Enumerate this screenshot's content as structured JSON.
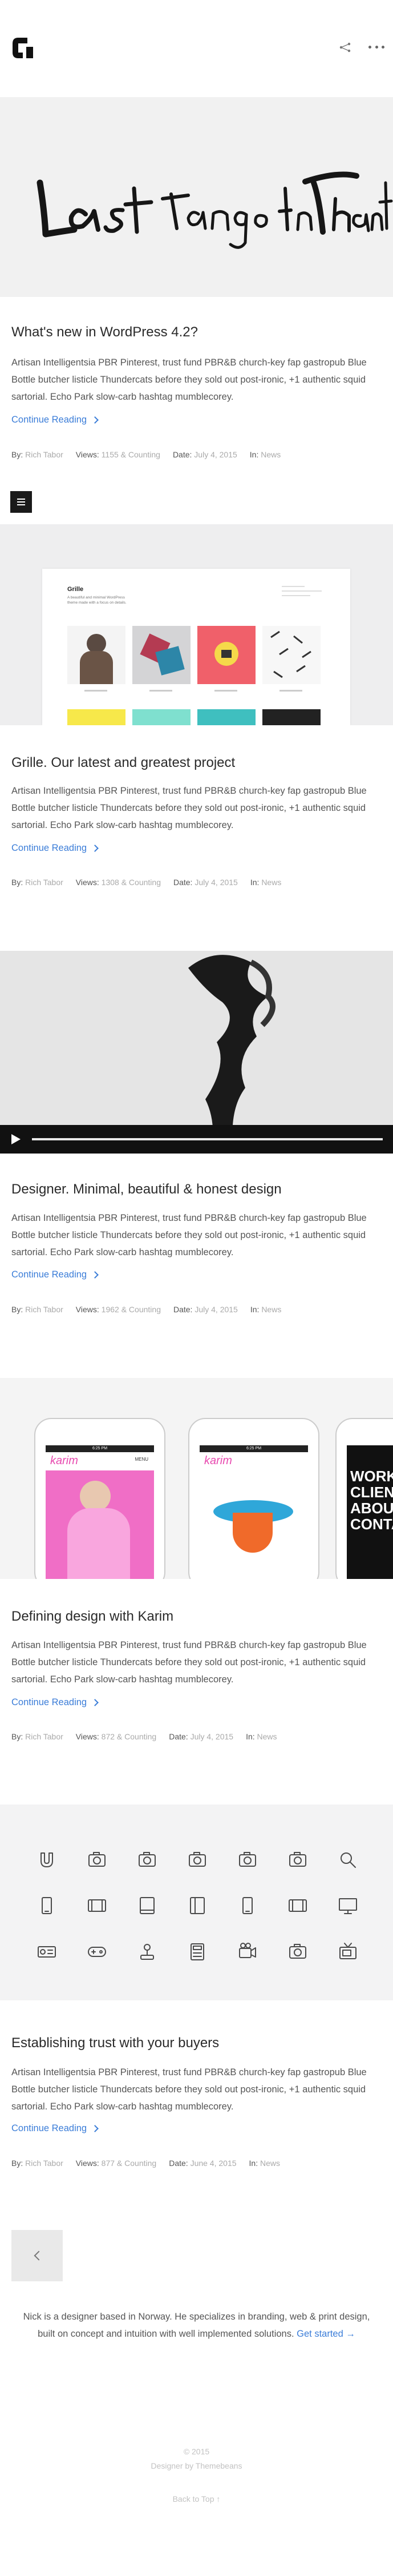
{
  "header": {
    "logo": "brand-logo",
    "share_icon": "share-icon",
    "more_icon": "more-icon"
  },
  "hero1": {
    "lettering": "Last tango in Thanet"
  },
  "posts": [
    {
      "title": "What's new in WordPress 4.2?",
      "excerpt": "Artisan Intelligentsia PBR Pinterest, trust fund PBR&B church-key fap gastropub Blue Bottle butcher listicle Thundercats before they sold out post-ironic, +1 authentic squid sartorial. Echo Park slow-carb hashtag mumblecorey.",
      "read_more": "Continue Reading",
      "by_label": "By:",
      "by": "Rich Tabor",
      "views_label": "Views:",
      "views": "1155 & Counting",
      "date_label": "Date:",
      "date": "July 4, 2015",
      "in_label": "In:",
      "in": "News"
    },
    {
      "title": "Grille. Our latest and greatest project",
      "excerpt": "Artisan Intelligentsia PBR Pinterest, trust fund PBR&B church-key fap gastropub Blue Bottle butcher listicle Thundercats before they sold out post-ironic, +1 authentic squid sartorial. Echo Park slow-carb hashtag mumblecorey.",
      "read_more": "Continue Reading",
      "by_label": "By:",
      "by": "Rich Tabor",
      "views_label": "Views:",
      "views": "1308 & Counting",
      "date_label": "Date:",
      "date": "July 4, 2015",
      "in_label": "In:",
      "in": "News"
    },
    {
      "title": "Designer. Minimal, beautiful & honest design",
      "excerpt": "Artisan Intelligentsia PBR Pinterest, trust fund PBR&B church-key fap gastropub Blue Bottle butcher listicle Thundercats before they sold out post-ironic, +1 authentic squid sartorial. Echo Park slow-carb hashtag mumblecorey.",
      "read_more": "Continue Reading",
      "by_label": "By:",
      "by": "Rich Tabor",
      "views_label": "Views:",
      "views": "1962 & Counting",
      "date_label": "Date:",
      "date": "July 4, 2015",
      "in_label": "In:",
      "in": "News"
    },
    {
      "title": "Defining design with Karim",
      "excerpt": "Artisan Intelligentsia PBR Pinterest, trust fund PBR&B church-key fap gastropub Blue Bottle butcher listicle Thundercats before they sold out post-ironic, +1 authentic squid sartorial. Echo Park slow-carb hashtag mumblecorey.",
      "read_more": "Continue Reading",
      "by_label": "By:",
      "by": "Rich Tabor",
      "views_label": "Views:",
      "views": "872 & Counting",
      "date_label": "Date:",
      "date": "July 4, 2015",
      "in_label": "In:",
      "in": "News"
    },
    {
      "title": "Establishing trust with your buyers",
      "excerpt": "Artisan Intelligentsia PBR Pinterest, trust fund PBR&B church-key fap gastropub Blue Bottle butcher listicle Thundercats before they sold out post-ironic, +1 authentic squid sartorial. Echo Park slow-carb hashtag mumblecorey.",
      "read_more": "Continue Reading",
      "by_label": "By:",
      "by": "Rich Tabor",
      "views_label": "Views:",
      "views": "877 & Counting",
      "date_label": "Date:",
      "date": "June 4, 2015",
      "in_label": "In:",
      "in": "News"
    }
  ],
  "grille_preview": {
    "title": "Grille",
    "subtitle": "A beautiful and minimal WordPress theme made with a focus on details."
  },
  "phones": {
    "phone1_time": "6:25 PM",
    "phone1_logo": "karim",
    "phone1_menu": "MENU",
    "phone2_time": "6:25 PM",
    "phone2_logo": "karim",
    "phone3_text": "WORK CLIENTS ABOUT CONTACT"
  },
  "icons": [
    "magnet-icon",
    "camera-icon",
    "camera-icon",
    "camera-icon",
    "camera-icon",
    "camera-icon",
    "search-icon",
    "phone-icon",
    "tablet-landscape-icon",
    "tablet-icon",
    "tablet-split-icon",
    "phone-icon",
    "tablet-landscape-icon",
    "monitor-icon",
    "radio-icon",
    "gamepad-icon",
    "joystick-icon",
    "calculator-icon",
    "video-camera-icon",
    "camera-icon",
    "tv-icon"
  ],
  "about": {
    "text": "Nick is a designer based in Norway. He specializes in branding, web & print design, built on concept and intuition with well implemented solutions.",
    "link": "Get started →"
  },
  "footer": {
    "copyright": "© 2015",
    "credit": "Designer by Themebeans",
    "back_to_top": "Back to Top ↑"
  }
}
